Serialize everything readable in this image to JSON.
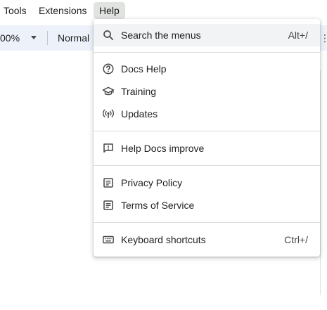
{
  "menubar": {
    "items": [
      {
        "label": "Tools"
      },
      {
        "label": "Extensions"
      },
      {
        "label": "Help"
      }
    ]
  },
  "toolbar": {
    "zoom_value": "00%",
    "style_value": "Normal"
  },
  "help_menu": {
    "search": {
      "label": "Search the menus",
      "shortcut": "Alt+/",
      "icon": "search-icon"
    },
    "docs_help": {
      "label": "Docs Help",
      "icon": "help-circle-icon"
    },
    "training": {
      "label": "Training",
      "icon": "graduation-cap-icon"
    },
    "updates": {
      "label": "Updates",
      "icon": "broadcast-icon"
    },
    "improve": {
      "label": "Help Docs improve",
      "icon": "feedback-icon"
    },
    "privacy": {
      "label": "Privacy Policy",
      "icon": "document-icon"
    },
    "terms": {
      "label": "Terms of Service",
      "icon": "document-icon"
    },
    "shortcuts": {
      "label": "Keyboard shortcuts",
      "shortcut": "Ctrl+/",
      "icon": "keyboard-icon"
    }
  },
  "colors": {
    "menu_text": "#1f1f1f",
    "active_menu_bg": "#e1e3e1",
    "toolbar_bg": "#edf2fa",
    "hover_row_bg": "#f1f3f4",
    "separator": "#dadce0"
  }
}
